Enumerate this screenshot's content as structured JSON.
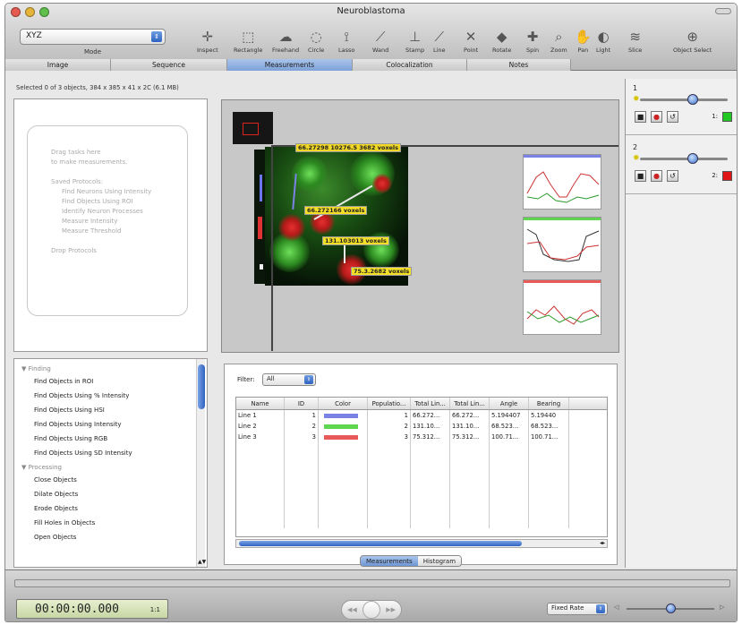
{
  "window": {
    "title": "Neuroblastoma"
  },
  "toolbar": {
    "mode_value": "XYZ",
    "mode_label": "Mode",
    "tools": [
      {
        "label": "Inspect",
        "icon": "crosshair-icon",
        "glyph": "✛"
      },
      {
        "label": "Rectangle",
        "icon": "rectangle-icon",
        "glyph": "⬚"
      },
      {
        "label": "Freehand",
        "icon": "freehand-icon",
        "glyph": "☁"
      },
      {
        "label": "Circle",
        "icon": "circle-icon",
        "glyph": "◌"
      },
      {
        "label": "Lasso",
        "icon": "lasso-icon",
        "glyph": "⟟"
      },
      {
        "label": "Wand",
        "icon": "wand-icon",
        "glyph": "⟋"
      },
      {
        "label": "Stamp",
        "icon": "stamp-icon",
        "glyph": "⊥"
      },
      {
        "label": "Line",
        "icon": "line-icon",
        "glyph": "⟋"
      },
      {
        "label": "Point",
        "icon": "point-icon",
        "glyph": "✕"
      },
      {
        "label": "Rotate",
        "icon": "rotate-icon",
        "glyph": "◆"
      },
      {
        "label": "Spin",
        "icon": "spin-icon",
        "glyph": "✚"
      },
      {
        "label": "Zoom",
        "icon": "zoom-icon",
        "glyph": "⌕"
      },
      {
        "label": "Pan",
        "icon": "pan-icon",
        "glyph": "✋"
      },
      {
        "label": "Light",
        "icon": "light-icon",
        "glyph": "◐"
      },
      {
        "label": "Slice",
        "icon": "slice-icon",
        "glyph": "≋"
      },
      {
        "label": "Object Select",
        "icon": "object-select-icon",
        "glyph": "⊕"
      }
    ]
  },
  "tabs": [
    "Image",
    "Sequence",
    "Measurements",
    "Colocalization",
    "Notes"
  ],
  "status": "Selected 0 of 3 objects, 384 x 385 x 41 x 2C (6.1 MB)",
  "dropzone": [
    "Drag tasks here",
    "to make measurements.",
    "",
    "Saved Protocols:",
    "Find Neurons Using Intensity",
    "Find Objects Using ROI",
    "Identify Neuron Processes",
    "Measure Intensity",
    "Measure Threshold",
    "",
    "Drop Protocols"
  ],
  "tasks": {
    "groups": [
      {
        "name": "Finding",
        "items": [
          "Find Objects in ROI",
          "Find Objects Using % Intensity",
          "Find Objects Using HSI",
          "Find Objects Using Intensity",
          "Find Objects Using RGB",
          "Find Objects Using SD Intensity"
        ]
      },
      {
        "name": "Processing",
        "items": [
          "Close Objects",
          "Dilate Objects",
          "Erode Objects",
          "Fill Holes in Objects",
          "Open Objects"
        ]
      }
    ]
  },
  "viewer": {
    "labels": [
      "66.27298 10276.5 3682 voxels",
      "66.272166 voxels",
      "131.103013 voxels",
      "75.3.2682 voxels"
    ]
  },
  "filter": {
    "label": "Filter:",
    "value": "All"
  },
  "table": {
    "columns": [
      "Name",
      "ID",
      "Color",
      "Populatio...",
      "Total Lin...",
      "Total Lin...",
      "Angle",
      "Bearing"
    ],
    "rows": [
      {
        "name": "Line 1",
        "id": "1",
        "color": "#7b82e6",
        "pop": "1",
        "tl1": "66.272...",
        "tl2": "66.272...",
        "angle": "5.194407",
        "bearing": "5.19440"
      },
      {
        "name": "Line 2",
        "id": "2",
        "color": "#5fd64f",
        "pop": "2",
        "tl1": "131.10...",
        "tl2": "131.10...",
        "angle": "68.523...",
        "bearing": "68.523..."
      },
      {
        "name": "Line 3",
        "id": "3",
        "color": "#e85a5a",
        "pop": "3",
        "tl1": "75.312...",
        "tl2": "75.312...",
        "angle": "100.71...",
        "bearing": "100.71..."
      }
    ]
  },
  "bottom_tabs": [
    "Measurements",
    "Histogram"
  ],
  "channels": [
    {
      "num": "1",
      "tag": "1:",
      "color": "#22c822",
      "level": 0.6
    },
    {
      "num": "2",
      "tag": "2:",
      "color": "#e01515",
      "level": 0.6
    }
  ],
  "playback": {
    "timecode": "00:00:00.000",
    "frame": "1:1",
    "rate": "Fixed Rate",
    "speed": 0.5
  },
  "colors": {
    "accent": "#3f75cf",
    "timecode_bg": "#d8e3b8"
  }
}
